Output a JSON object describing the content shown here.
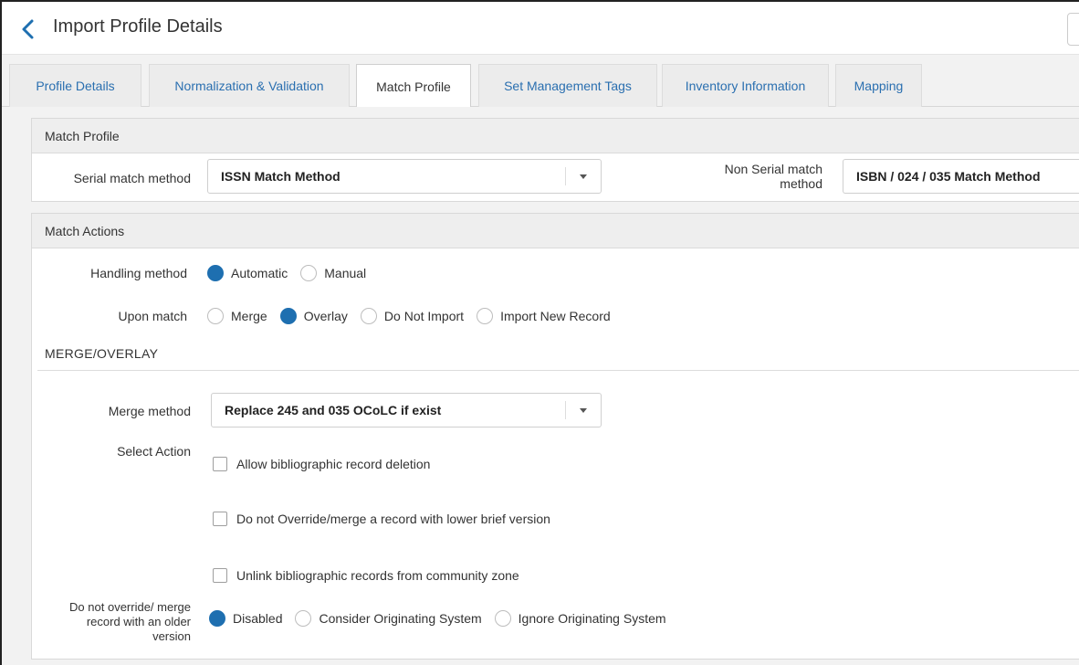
{
  "header": {
    "title": "Import Profile Details"
  },
  "tabs": [
    {
      "label": "Profile Details"
    },
    {
      "label": "Normalization & Validation"
    },
    {
      "label": "Match Profile"
    },
    {
      "label": "Set Management Tags"
    },
    {
      "label": "Inventory Information"
    },
    {
      "label": "Mapping"
    }
  ],
  "match_profile": {
    "heading": "Match Profile",
    "serial_label": "Serial match method",
    "serial_value": "ISSN Match Method",
    "non_serial_label_line1": "Non Serial match",
    "non_serial_label_line2": "method",
    "non_serial_value": "ISBN / 024 / 035 Match Method"
  },
  "match_actions": {
    "heading": "Match Actions",
    "handling_label": "Handling method",
    "handling_options": [
      "Automatic",
      "Manual"
    ],
    "handling_selected": "Automatic",
    "upon_label": "Upon match",
    "upon_options": [
      "Merge",
      "Overlay",
      "Do Not Import",
      "Import New Record"
    ],
    "upon_selected": "Overlay",
    "merge_overlay_title": "MERGE/OVERLAY",
    "merge_method_label": "Merge method",
    "merge_method_value": "Replace 245 and 035 OCoLC if exist",
    "select_action_label": "Select Action",
    "checkboxes": [
      {
        "label": "Allow bibliographic record deletion",
        "checked": false
      },
      {
        "label": "Do not Override/merge a record with lower brief version",
        "checked": false
      },
      {
        "label": "Unlink bibliographic records from community zone",
        "checked": false
      }
    ],
    "older_label_lines": [
      "Do not override/ merge",
      "record with an older",
      "version"
    ],
    "older_options": [
      "Disabled",
      "Consider Originating System",
      "Ignore Originating System"
    ],
    "older_selected": "Disabled"
  },
  "colors": {
    "accent": "#1e6fb0",
    "tab_link": "#2a6fb0",
    "background": "#f2f2f2"
  }
}
